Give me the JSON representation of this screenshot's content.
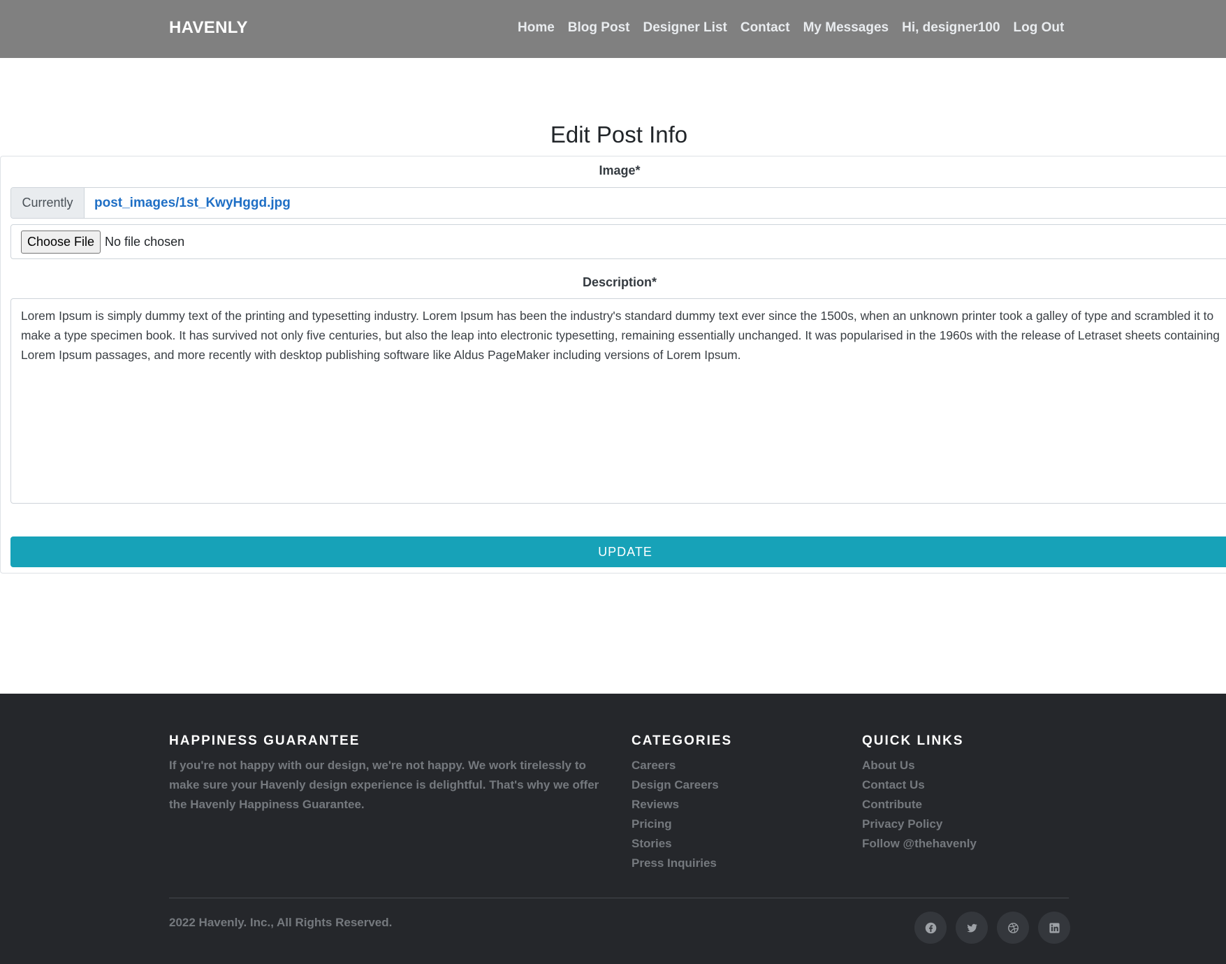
{
  "header": {
    "brand": "HAVENLY",
    "nav": [
      {
        "label": "Home"
      },
      {
        "label": "Blog Post"
      },
      {
        "label": "Designer List"
      },
      {
        "label": "Contact"
      },
      {
        "label": "My Messages"
      },
      {
        "label": "Hi, designer100"
      },
      {
        "label": "Log Out"
      }
    ]
  },
  "main": {
    "title": "Edit Post Info",
    "image_label": "Image*",
    "currently_label": "Currently",
    "current_file": "post_images/1st_KwyHggd.jpg",
    "choose_file_label": "Choose File",
    "no_file_text": "No file chosen",
    "description_label": "Description*",
    "description_value": "Lorem Ipsum is simply dummy text of the printing and typesetting industry. Lorem Ipsum has been the industry's standard dummy text ever since the 1500s, when an unknown printer took a galley of type and scrambled it to make a type specimen book. It has survived not only five centuries, but also the leap into electronic typesetting, remaining essentially unchanged. It was popularised in the 1960s with the release of Letraset sheets containing Lorem Ipsum passages, and more recently with desktop publishing software like Aldus PageMaker including versions of Lorem Ipsum.",
    "update_label": "UPDATE"
  },
  "footer": {
    "guarantee_title": "HAPPINESS GUARANTEE",
    "guarantee_text": "If you're not happy with our design, we're not happy. We work tirelessly to make sure your Havenly design experience is delightful. That's why we offer the Havenly Happiness Guarantee.",
    "categories_title": "CATEGORIES",
    "categories": [
      "Careers",
      "Design Careers",
      "Reviews",
      "Pricing",
      "Stories",
      "Press Inquiries"
    ],
    "quick_links_title": "QUICK LINKS",
    "quick_links": [
      "About Us",
      "Contact Us",
      "Contribute",
      "Privacy Policy",
      "Follow @thehavenly"
    ],
    "copyright": "2022 Havenly. Inc., All Rights Reserved.",
    "social_icons": [
      "facebook-icon",
      "twitter-icon",
      "dribbble-icon",
      "linkedin-icon"
    ]
  },
  "colors": {
    "header_bg": "#808080",
    "accent": "#17a2b8",
    "link": "#1f6fc5",
    "footer_bg": "#25272b"
  }
}
